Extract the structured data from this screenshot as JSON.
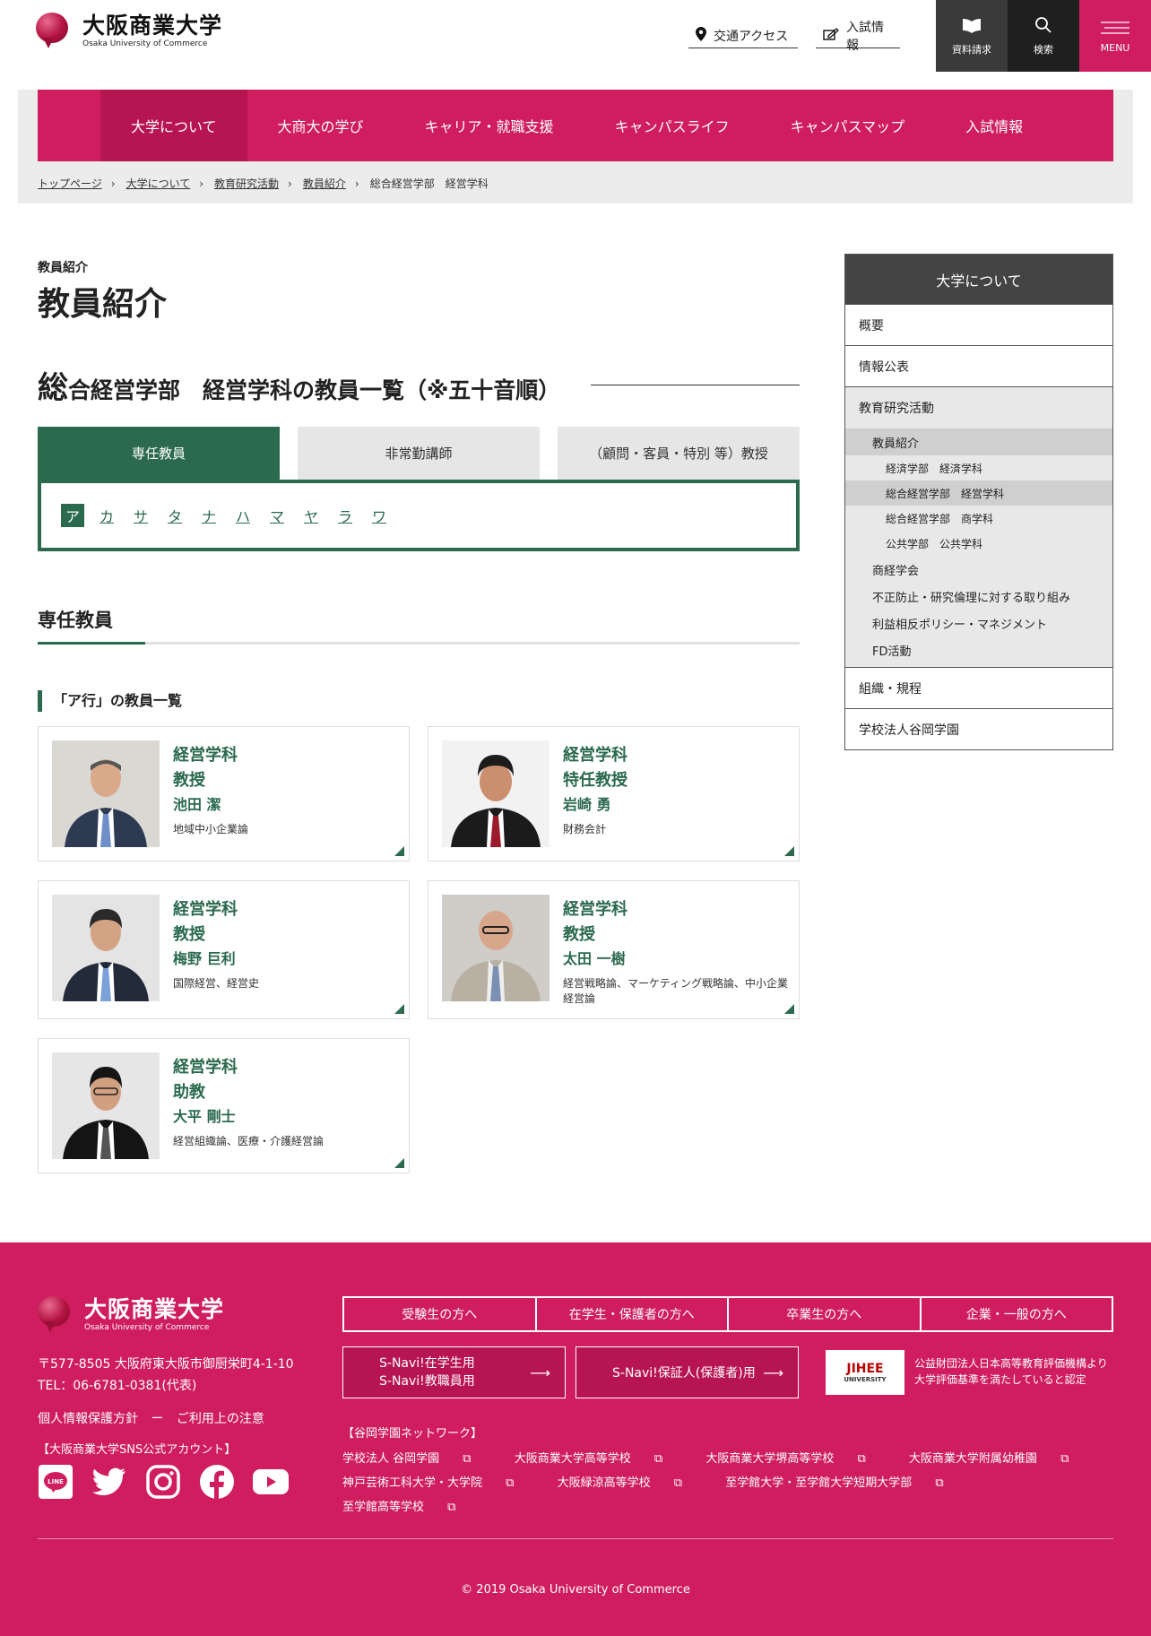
{
  "header": {
    "logo_jp": "大阪商業大学",
    "logo_en": "Osaka University of Commerce",
    "access": "交通アクセス",
    "admissions": "入試情報",
    "request": "資料請求",
    "search": "検索",
    "menu": "MENU"
  },
  "nav": [
    "大学について",
    "大商大の学び",
    "キャリア・就職支援",
    "キャンパスライフ",
    "キャンパスマップ",
    "入試情報"
  ],
  "breadcrumb": [
    "トップページ",
    "大学について",
    "教育研究活動",
    "教員紹介",
    "総合経営学部　経営学科"
  ],
  "main": {
    "small_title": "教員紹介",
    "page_title": "教員紹介",
    "section_first": "総",
    "section_rest": "合経営学部　経営学科の教員一覧（※五十音順）",
    "tabs": [
      "専任教員",
      "非常勤講師",
      "（顧問・客員・特別 等）教授"
    ],
    "kana": [
      "ア",
      "カ",
      "サ",
      "タ",
      "ナ",
      "ハ",
      "マ",
      "ヤ",
      "ラ",
      "ワ"
    ],
    "h2": "専任教員",
    "h3": "「ア行」の教員一覧",
    "cards": [
      {
        "dept": "経営学科",
        "rank": "教授",
        "name": "池田 潔",
        "field": "地域中小企業論"
      },
      {
        "dept": "経営学科",
        "rank": "特任教授",
        "name": "岩崎 勇",
        "field": "財務会計"
      },
      {
        "dept": "経営学科",
        "rank": "教授",
        "name": "梅野 巨利",
        "field": "国際経営、経営史"
      },
      {
        "dept": "経営学科",
        "rank": "教授",
        "name": "太田 一樹",
        "field": "経営戦略論、マーケティング戦略論、中小企業経営論"
      },
      {
        "dept": "経営学科",
        "rank": "助教",
        "name": "大平 剛士",
        "field": "経営組織論、医療・介護経営論"
      }
    ]
  },
  "sidebar": {
    "title": "大学について",
    "items": [
      "概要",
      "情報公表"
    ],
    "group": "教育研究活動",
    "sub": "教員紹介",
    "subsub": [
      "経済学部　経済学科",
      "総合経営学部　経営学科",
      "総合経営学部　商学科",
      "公共学部　公共学科"
    ],
    "more": [
      "商経学会",
      "不正防止・研究倫理に対する取り組み",
      "利益相反ポリシー・マネジメント",
      "FD活動"
    ],
    "bottom": [
      "組織・規程",
      "学校法人谷岡学園"
    ]
  },
  "footer": {
    "logo_jp": "大阪商業大学",
    "logo_en": "Osaka University of Commerce",
    "address": "〒577-8505 大阪府東大阪市御厨栄町4-1-10",
    "tel": "TEL：06-6781-0381(代表)",
    "privacy": "個人情報保護方針",
    "dash": "ー",
    "terms": "ご利用上の注意",
    "sns_label": "【大阪商業大学SNS公式アカウント】",
    "audience": [
      "受験生の方へ",
      "在学生・保護者の方へ",
      "卒業生の方へ",
      "企業・一般の方へ"
    ],
    "snavi1_a": "S-Navi!在学生用",
    "snavi1_b": "S-Navi!教職員用",
    "snavi2": "S-Navi!保証人(保護者)用",
    "jihee": "JIHEE",
    "jihee_sub": "UNIVERSITY",
    "jihee_text1": "公益財団法人日本高等教育評価機構より",
    "jihee_text2": "大学評価基準を満たしていると認定",
    "network_label": "【谷岡学園ネットワーク】",
    "network": [
      "学校法人 谷岡学園",
      "大阪商業大学高等学校",
      "大阪商業大学堺高等学校",
      "大阪商業大学附属幼稚園",
      "神戸芸術工科大学・大学院",
      "大阪緑涼高等学校",
      "至学館大学・至学館大学短期大学部",
      "至学館高等学校"
    ],
    "copyright": "© 2019 Osaka University of Commerce"
  },
  "colors": {
    "brand": "#cf1d5f",
    "accent": "#2b6a4f",
    "dark": "#444444"
  }
}
